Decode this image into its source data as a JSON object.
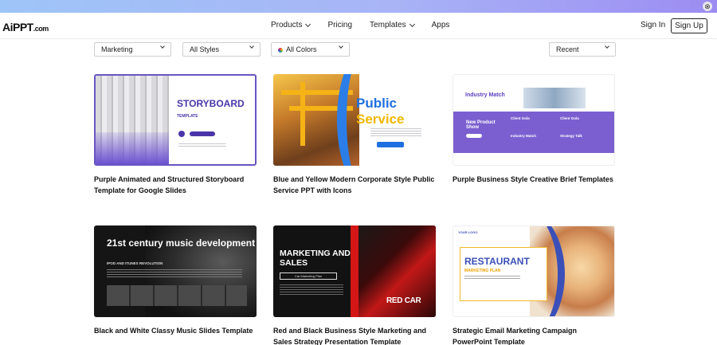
{
  "topbar": {
    "close_glyph": "⊗"
  },
  "nav": {
    "logo": "AiPPT",
    "logo_suffix": ".com",
    "links": [
      "Products",
      "Pricing",
      "Templates",
      "Apps"
    ],
    "sign_in": "Sign In",
    "sign_up": "Sign Up"
  },
  "filters": {
    "category": "Marketing",
    "style": "All Styles",
    "color": "All Colors",
    "sort": "Recent"
  },
  "cards": [
    {
      "title": "Purple Animated and Structured Storyboard Template for Google Slides",
      "thumb": {
        "heading": "STORYBOARD",
        "sub": "TEMPLATE"
      }
    },
    {
      "title": "Blue and Yellow Modern Corporate Style Public Service PPT with Icons",
      "thumb": {
        "heading1": "Public",
        "heading2": "Service"
      }
    },
    {
      "title": "Purple Business Style Creative Brief Templates",
      "thumb": {
        "heading": "Industry Match",
        "band_title": "New Product Show",
        "b1": "Client Gola",
        "b2": "Client Gola",
        "b3": "Industry Match",
        "b4": "Strategy Talk"
      }
    },
    {
      "title": "Black and White Classy Music Slides Template",
      "thumb": {
        "heading": "21st century music development",
        "sub": "IPOD AND ITUNES REVOLUTION"
      }
    },
    {
      "title": "Red and Black Business Style Marketing and Sales Strategy Presentation Template",
      "thumb": {
        "heading": "MARKETING AND SALES",
        "box": "Car Marketing Plan",
        "corner": "RED CAR"
      }
    },
    {
      "title": "Strategic Email Marketing Campaign PowerPoint Template",
      "thumb": {
        "logo": "YOUR LOGO",
        "heading": "RESTAURANT",
        "sub": "MARKETING PLAN"
      }
    }
  ]
}
